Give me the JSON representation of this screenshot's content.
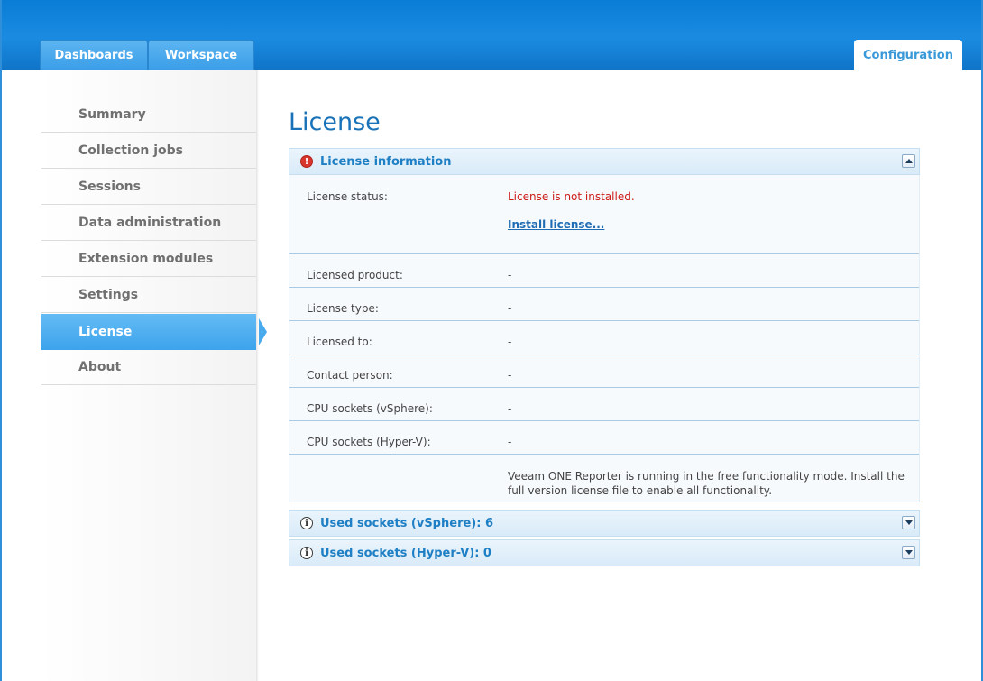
{
  "topnav": {
    "tabs": [
      {
        "label": "Dashboards",
        "active": false
      },
      {
        "label": "Workspace",
        "active": false
      }
    ],
    "config_tab": {
      "label": "Configuration",
      "active": true
    }
  },
  "sidebar": {
    "items": [
      {
        "label": "Summary",
        "active": false
      },
      {
        "label": "Collection jobs",
        "active": false
      },
      {
        "label": "Sessions",
        "active": false
      },
      {
        "label": "Data administration",
        "active": false
      },
      {
        "label": "Extension modules",
        "active": false
      },
      {
        "label": "Settings",
        "active": false
      },
      {
        "label": "License",
        "active": true
      },
      {
        "label": "About",
        "active": false
      }
    ]
  },
  "main": {
    "title": "License",
    "license_panel": {
      "title": "License information",
      "icon": "error-icon",
      "status_label": "License status:",
      "status_value": "License is not installed.",
      "install_link": "Install license...",
      "rows": [
        {
          "label": "Licensed product:",
          "value": "-"
        },
        {
          "label": "License type:",
          "value": "-"
        },
        {
          "label": "Licensed to:",
          "value": "-"
        },
        {
          "label": "Contact person:",
          "value": "-"
        },
        {
          "label": "CPU sockets (vSphere):",
          "value": "-"
        },
        {
          "label": "CPU sockets (Hyper-V):",
          "value": "-"
        }
      ],
      "note": "Veeam ONE Reporter is running in the free functionality mode. Install the full version license file to enable all functionality."
    },
    "collapsed_panels": [
      {
        "title": "Used sockets (vSphere): 6",
        "icon": "info-icon"
      },
      {
        "title": "Used sockets (Hyper-V): 0",
        "icon": "info-icon"
      }
    ]
  },
  "colors": {
    "accent": "#1a8be0",
    "title_blue": "#1a73b8",
    "error_red": "#cc1b16",
    "active_nav": "#49aaee"
  }
}
